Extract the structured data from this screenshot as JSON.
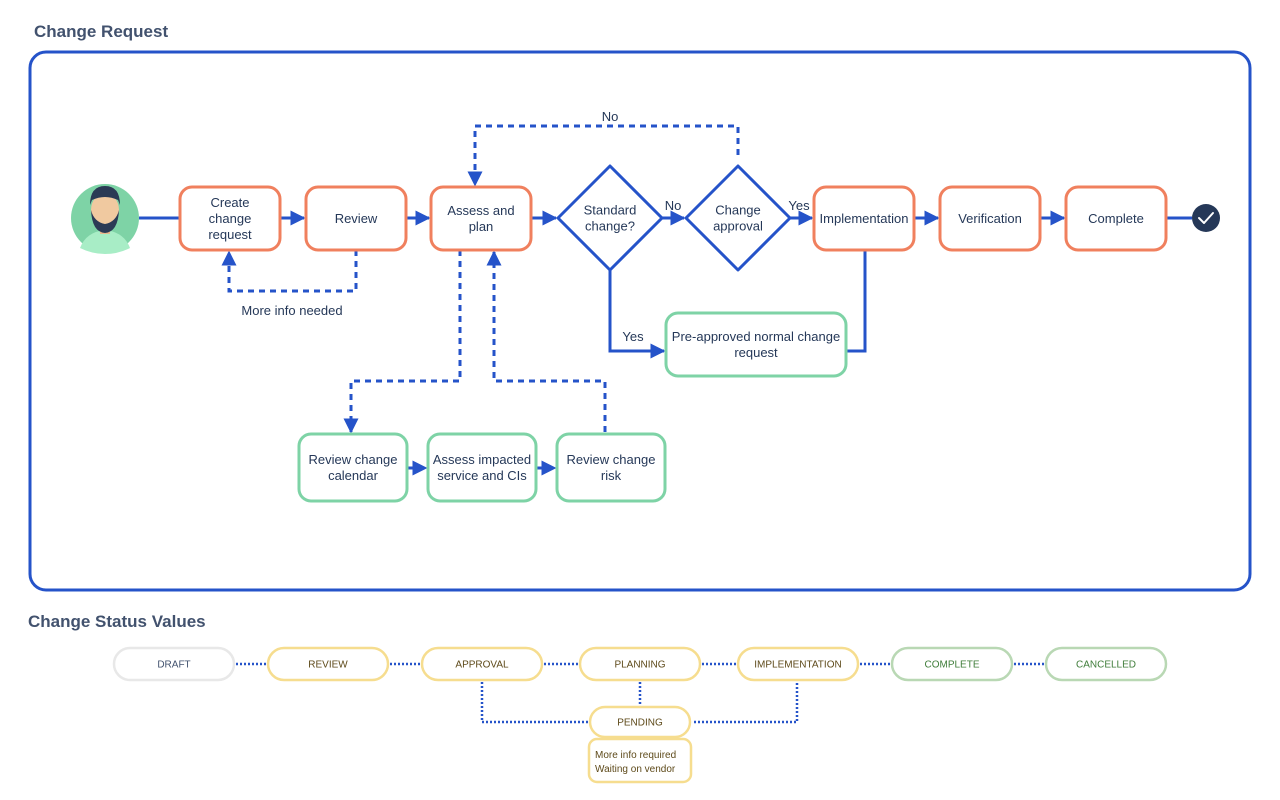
{
  "titles": {
    "change_request": "Change Request",
    "status_values": "Change Status Values"
  },
  "colors": {
    "frame": "#2553c9",
    "connector": "#2553c9",
    "process_border": "#f0805e",
    "sub_border": "#7ed3a6",
    "text": "#253858",
    "end_node": "#253858",
    "avatar_bg": "#7ed3a6",
    "status_yellow": "#f6dd8f",
    "status_green": "#b9d8b4",
    "status_gray": "#e8e8e8"
  },
  "flow": {
    "start": {
      "icon": "user-avatar-icon"
    },
    "nodes": [
      {
        "id": "create",
        "lines": [
          "Create",
          "change",
          "request"
        ],
        "kind": "process"
      },
      {
        "id": "review",
        "lines": [
          "Review"
        ],
        "kind": "process"
      },
      {
        "id": "assess",
        "lines": [
          "Assess and",
          "plan"
        ],
        "kind": "process"
      },
      {
        "id": "standard",
        "lines": [
          "Standard",
          "change?"
        ],
        "kind": "decision"
      },
      {
        "id": "approval",
        "lines": [
          "Change",
          "approval"
        ],
        "kind": "decision"
      },
      {
        "id": "implementation",
        "lines": [
          "Implementation"
        ],
        "kind": "process"
      },
      {
        "id": "verification",
        "lines": [
          "Verification"
        ],
        "kind": "process"
      },
      {
        "id": "complete",
        "lines": [
          "Complete"
        ],
        "kind": "process"
      },
      {
        "id": "preapproved",
        "lines": [
          "Pre-approved normal change",
          "request"
        ],
        "kind": "sub"
      },
      {
        "id": "review-calendar",
        "lines": [
          "Review change",
          "calendar"
        ],
        "kind": "sub"
      },
      {
        "id": "assess-impacted",
        "lines": [
          "Assess impacted",
          "service and CIs"
        ],
        "kind": "sub"
      },
      {
        "id": "review-risk",
        "lines": [
          "Review change",
          "risk"
        ],
        "kind": "sub"
      }
    ],
    "end": {
      "icon": "checkmark-icon"
    },
    "labels": {
      "more_info": "More info needed",
      "no_top": "No",
      "no_mid": "No",
      "yes_right": "Yes",
      "yes_down": "Yes"
    }
  },
  "statuses": {
    "items": [
      {
        "id": "draft",
        "label": "DRAFT",
        "tone": "gray"
      },
      {
        "id": "review",
        "label": "REVIEW",
        "tone": "yellow"
      },
      {
        "id": "approval",
        "label": "APPROVAL",
        "tone": "yellow"
      },
      {
        "id": "planning",
        "label": "PLANNING",
        "tone": "yellow"
      },
      {
        "id": "implementation",
        "label": "IMPLEMENTATION",
        "tone": "yellow"
      },
      {
        "id": "complete",
        "label": "COMPLETE",
        "tone": "green"
      },
      {
        "id": "cancelled",
        "label": "CANCELLED",
        "tone": "green"
      }
    ],
    "pending": {
      "label": "PENDING",
      "reasons": [
        "More info required",
        "Waiting on vendor"
      ]
    }
  }
}
